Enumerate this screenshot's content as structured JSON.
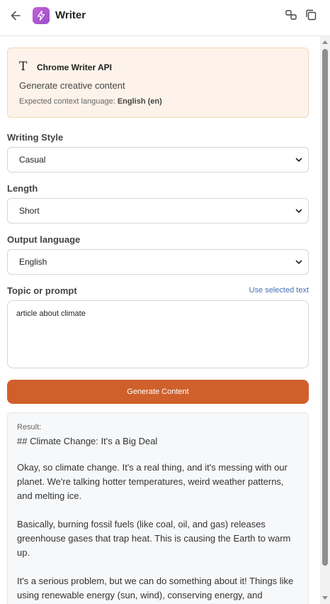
{
  "header": {
    "title": "Writer",
    "icons": [
      "back-arrow-icon",
      "lightning-icon",
      "link-icon",
      "copy-icon"
    ],
    "accent": "#b457d1"
  },
  "api_card": {
    "icon_glyph": "T",
    "name": "Chrome Writer API",
    "description": "Generate creative content",
    "lang_prefix": "Expected context language:",
    "lang_value": "English (en)",
    "background": "#fdf3ea"
  },
  "writing_style": {
    "label": "Writing Style",
    "value": "Casual"
  },
  "length": {
    "label": "Length",
    "value": "Short"
  },
  "output_language": {
    "label": "Output language",
    "value": "English"
  },
  "topic": {
    "label": "Topic or prompt",
    "use_selected": "Use selected text",
    "value": "article about climate"
  },
  "generate_button": {
    "label": "Generate Content",
    "color": "#d0602b"
  },
  "result": {
    "label": "Result:",
    "heading": "## Climate Change: It's a Big Deal",
    "paragraphs": [
      "Okay, so climate change. It's a real thing, and it's messing with our planet. We're talking hotter temperatures, weird weather patterns, and melting ice.",
      "Basically, burning fossil fuels (like coal, oil, and gas) releases greenhouse gases that trap heat. This is causing the Earth to warm up.",
      "It's a serious problem, but we can do something about it! Things like using renewable energy (sun, wind), conserving energy, and"
    ]
  }
}
